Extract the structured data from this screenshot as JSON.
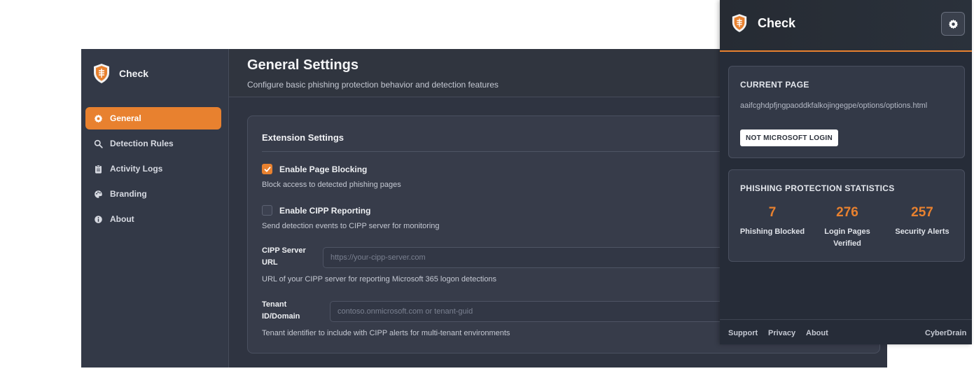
{
  "brand": {
    "name": "Check"
  },
  "sidebar": {
    "items": [
      {
        "label": "General",
        "icon": "gear-icon",
        "active": true
      },
      {
        "label": "Detection Rules",
        "icon": "search-icon",
        "active": false
      },
      {
        "label": "Activity Logs",
        "icon": "clipboard-icon",
        "active": false
      },
      {
        "label": "Branding",
        "icon": "palette-icon",
        "active": false
      },
      {
        "label": "About",
        "icon": "info-icon",
        "active": false
      }
    ]
  },
  "header": {
    "title": "General Settings",
    "subtitle": "Configure basic phishing protection behavior and detection features"
  },
  "settings": {
    "title": "Extension Settings",
    "page_blocking": {
      "label": "Enable Page Blocking",
      "checked": true,
      "help": "Block access to detected phishing pages"
    },
    "cipp_reporting": {
      "label": "Enable CIPP Reporting",
      "checked": false,
      "help": "Send detection events to CIPP server for monitoring"
    },
    "cipp_url": {
      "label": "CIPP Server URL",
      "value": "",
      "placeholder": "https://your-cipp-server.com",
      "help": "URL of your CIPP server for reporting Microsoft 365 logon detections"
    },
    "tenant": {
      "label": "Tenant ID/Domain",
      "value": "",
      "placeholder": "contoso.onmicrosoft.com or tenant-guid",
      "help": "Tenant identifier to include with CIPP alerts for multi-tenant environments"
    }
  },
  "popup": {
    "brand": "Check",
    "current_page": {
      "title": "CURRENT PAGE",
      "url": "aaifcghdpfjngpaoddkfalkojingegpe/options/options.html",
      "badge": "NOT MICROSOFT LOGIN"
    },
    "stats": {
      "title": "PHISHING PROTECTION STATISTICS",
      "items": [
        {
          "value": "7",
          "label": "Phishing Blocked"
        },
        {
          "value": "276",
          "label": "Login Pages Verified"
        },
        {
          "value": "257",
          "label": "Security Alerts"
        }
      ]
    },
    "footer": {
      "links": [
        "Support",
        "Privacy",
        "About"
      ],
      "company": "CyberDrain"
    }
  },
  "colors": {
    "accent": "#e8812f",
    "background": "#2f3441",
    "sidebar": "#333947"
  }
}
